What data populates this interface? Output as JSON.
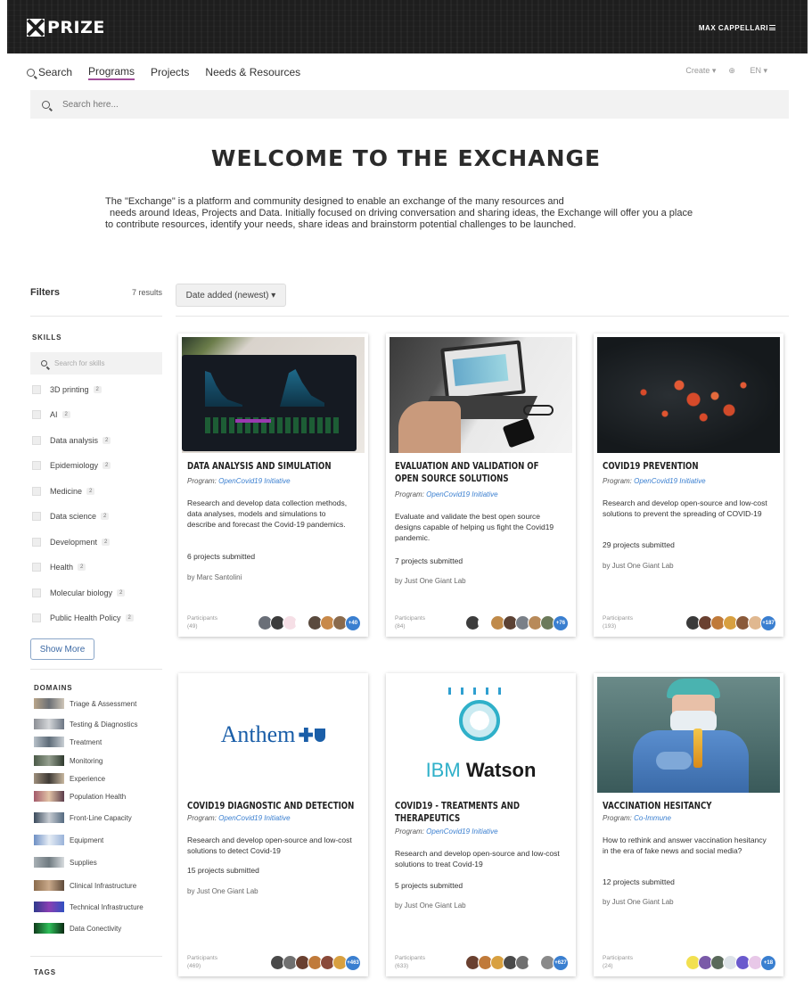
{
  "header": {
    "logo_text": "PRIZE",
    "user_name": "MAX CAPPELLARI"
  },
  "nav": {
    "search": "Search",
    "programs": "Programs",
    "projects": "Projects",
    "needs": "Needs & Resources",
    "create": "Create ▾",
    "language": "EN ▾"
  },
  "searchbar": {
    "placeholder": "Search here..."
  },
  "hero": {
    "title": "WELCOME TO THE EXCHANGE",
    "lines": [
      "The \"Exchange\" is a platform and community designed to enable an exchange of the many resources and",
      "needs around Ideas, Projects and Data. Initially focused on driving conversation and sharing ideas, the Exchange  will offer you a place",
      "to contribute resources, identify your needs, share ideas and brainstorm potential challenges to be launched."
    ]
  },
  "filters": {
    "title": "Filters",
    "results": "7 results",
    "sort_label": "Date added (newest) ▾",
    "skills_title": "SKILLS",
    "skill_search_placeholder": "Search for skills",
    "skills": [
      {
        "label": "3D printing",
        "count": "2"
      },
      {
        "label": "AI",
        "count": "2"
      },
      {
        "label": "Data analysis",
        "count": "2"
      },
      {
        "label": "Epidemiology",
        "count": "2"
      },
      {
        "label": "Medicine",
        "count": "2"
      },
      {
        "label": "Data science",
        "count": "2"
      },
      {
        "label": "Development",
        "count": "2"
      },
      {
        "label": "Health",
        "count": "2"
      },
      {
        "label": "Molecular biology",
        "count": "2"
      },
      {
        "label": "Public Health Policy",
        "count": "2"
      }
    ],
    "show_more": "Show More",
    "domains_title": "DOMAINS",
    "domains": [
      "Triage & Assessment",
      "Testing & Diagnostics",
      "Treatment",
      "Monitoring",
      "Experience",
      "Population Health",
      "Front-Line Capacity",
      "Equipment",
      "Supplies",
      "Clinical Infrastructure",
      "Technical Infrastructure",
      "Data Conectivity"
    ],
    "tags_title": "TAGS"
  },
  "cards": [
    {
      "title_lines": [
        "DATA ANALYSIS AND SIMULATION"
      ],
      "program_prefix": "Program:",
      "program": "OpenCovid19 Initiative",
      "description": "Research and develop data collection methods, data analyses, models and simulations to describe and forecast the Covid-19 pandemics.",
      "submitted": "6 projects submitted",
      "by": "by Marc Santolini",
      "participants_label": "Participants",
      "participants_count": "(49)",
      "more": "+40"
    },
    {
      "title_lines": [
        "EVALUATION AND VALIDATION OF",
        "OPEN SOURCE SOLUTIONS"
      ],
      "program_prefix": "Program:",
      "program": "OpenCovid19 Initiative",
      "description": "Evaluate and validate the best open source designs capable of helping us fight the Covid19 pandemic.",
      "submitted": "7 projects submitted",
      "by": "by Just One Giant Lab",
      "participants_label": "Participants",
      "participants_count": "(84)",
      "more": "+76"
    },
    {
      "title_lines": [
        "COVID19 PREVENTION"
      ],
      "program_prefix": "Program:",
      "program": "OpenCovid19 Initiative",
      "description": "Research and develop open-source and low-cost solutions to prevent the spreading of COVID-19",
      "submitted": "29 projects submitted",
      "by": "by Just One Giant Lab",
      "participants_label": "Participants",
      "participants_count": "(193)",
      "more": "+187"
    },
    {
      "logo_text": "Anthem",
      "title_lines": [
        "COVID19 DIAGNOSTIC AND DETECTION"
      ],
      "program_prefix": "Program:",
      "program": "OpenCovid19 Initiative",
      "description": "Research and develop open-source and low-cost solutions to detect Covid-19",
      "submitted": "15 projects submitted",
      "by": "by Just One Giant Lab",
      "participants_label": "Participants",
      "participants_count": "(469)",
      "more": "+463"
    },
    {
      "logo_text_a": "IBM",
      "logo_text_b": "Watson",
      "title_lines": [
        "COVID19 - TREATMENTS AND",
        "THERAPEUTICS"
      ],
      "program_prefix": "Program:",
      "program": "OpenCovid19 Initiative",
      "description": "Research and develop open-source and low-cost solutions to treat Covid-19",
      "submitted": "5 projects submitted",
      "by": "by Just One Giant Lab",
      "participants_label": "Participants",
      "participants_count": "(633)",
      "more": "+627"
    },
    {
      "title_lines": [
        "VACCINATION HESITANCY"
      ],
      "program_prefix": "Program:",
      "program": "Co-Immune",
      "description": "How to rethink and answer vaccination hesitancy in the era of fake news and social media?",
      "submitted": "12 projects submitted",
      "by": "by Just One Giant Lab",
      "participants_label": "Participants",
      "participants_count": "(24)",
      "more": "+18"
    }
  ],
  "colors": {
    "accent": "#a24d9a",
    "link": "#3a7fd0",
    "header_bg": "#1e1e1e"
  }
}
